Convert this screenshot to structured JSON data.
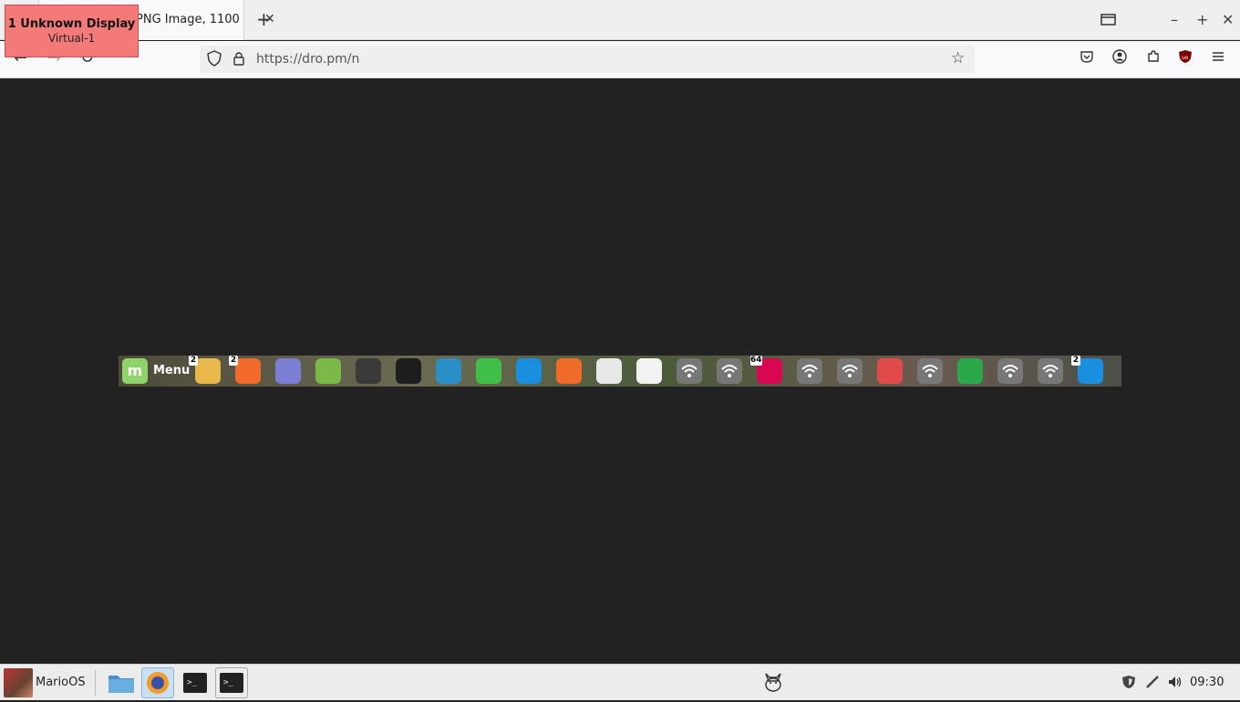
{
  "display_badge": {
    "line1": "1  Unknown Display",
    "line2": "Virtual-1"
  },
  "browser": {
    "tab": {
      "title": "PNG Image, 1100",
      "close": "✕"
    },
    "new_tab": "+",
    "window_controls": {
      "list_all": "▭",
      "minimize": "–",
      "maximize": "+",
      "close": "✕"
    },
    "nav": {
      "back": "←",
      "forward": "→",
      "reload": "↻"
    },
    "url": "https://dro.pm/n",
    "toolbar_icons": [
      "bookmark-star-icon",
      "pocket-icon",
      "account-icon",
      "extensions-icon",
      "ublock-icon",
      "hamburger-menu-icon"
    ]
  },
  "dock": {
    "menu_label": "Menu",
    "items": [
      {
        "name": "files",
        "badge": "2",
        "color": "#e8b94a"
      },
      {
        "name": "firefox-like",
        "badge": "2",
        "color": "#f26b2a"
      },
      {
        "name": "text-editor",
        "badge": "",
        "color": "#7a7fd4"
      },
      {
        "name": "web-app",
        "badge": "",
        "color": "#7ab84a"
      },
      {
        "name": "calculator",
        "badge": "",
        "color": "#3a3a3a"
      },
      {
        "name": "terminal",
        "badge": "",
        "color": "#1e1e1e"
      },
      {
        "name": "system-monitor",
        "badge": "",
        "color": "#2a8fc7"
      },
      {
        "name": "green-gem",
        "badge": "",
        "color": "#3fbf4a"
      },
      {
        "name": "blue-app",
        "badge": "",
        "color": "#1a8fe0"
      },
      {
        "name": "brave",
        "badge": "",
        "color": "#f06a2a"
      },
      {
        "name": "virtualbox",
        "badge": "",
        "color": "#e8e8e8"
      },
      {
        "name": "chart-app",
        "badge": "",
        "color": "#f2f2f2"
      },
      {
        "name": "network-1",
        "badge": "",
        "color": "#777"
      },
      {
        "name": "network-2",
        "badge": "",
        "color": "#777"
      },
      {
        "name": "debian",
        "badge": "64",
        "color": "#d70751"
      },
      {
        "name": "network-3",
        "badge": "",
        "color": "#777"
      },
      {
        "name": "network-4",
        "badge": "",
        "color": "#777"
      },
      {
        "name": "red-shield",
        "badge": "",
        "color": "#e04a4a"
      },
      {
        "name": "network-5",
        "badge": "",
        "color": "#777"
      },
      {
        "name": "green-shield",
        "badge": "",
        "color": "#2aa84a"
      },
      {
        "name": "network-6",
        "badge": "",
        "color": "#777"
      },
      {
        "name": "network-7",
        "badge": "",
        "color": "#777"
      },
      {
        "name": "refresh-app",
        "badge": "2",
        "color": "#1a8fe0"
      }
    ]
  },
  "taskbar": {
    "user": "MarioOS",
    "clock": "09:30",
    "apps": [
      "file-manager-icon",
      "firefox-icon",
      "terminal-icon",
      "terminal-2-icon"
    ],
    "tray": [
      "shield-icon",
      "pen-icon",
      "volume-icon"
    ]
  }
}
